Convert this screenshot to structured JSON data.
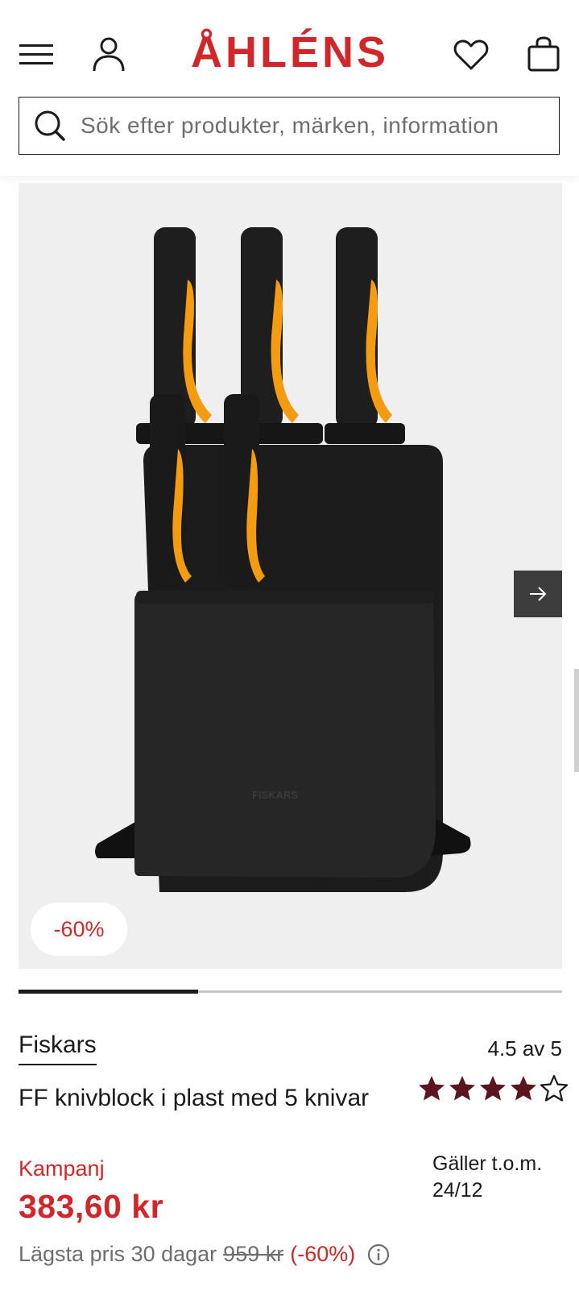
{
  "header": {
    "logo_text": "ÅHLÉNS",
    "search_placeholder": "Sök efter produkter, märken, information",
    "icons": [
      "menu-icon",
      "account-icon",
      "heart-icon",
      "shopping-bag-icon",
      "search-icon"
    ]
  },
  "gallery": {
    "discount_badge": "-60%",
    "next_icon": "arrow-right-icon",
    "progress": 0.33
  },
  "product": {
    "brand": "Fiskars",
    "name": "FF knivblock i plast med 5 knivar",
    "rating_text": "4.5 av 5",
    "rating_value": 4.5,
    "rating_max": 5,
    "campaign_label": "Kampanj",
    "price": "383,60 kr",
    "valid_until": "Gäller t.o.m. 24/12",
    "lowest_label": "Lägsta pris 30 dagar",
    "old_price": "959 kr",
    "lowest_discount": "(-60%)",
    "block_logo": "FISKARS"
  },
  "colors": {
    "brand_red": "#d1272b",
    "star_color": "#5c1420",
    "handle_orange": "#f39c12"
  }
}
